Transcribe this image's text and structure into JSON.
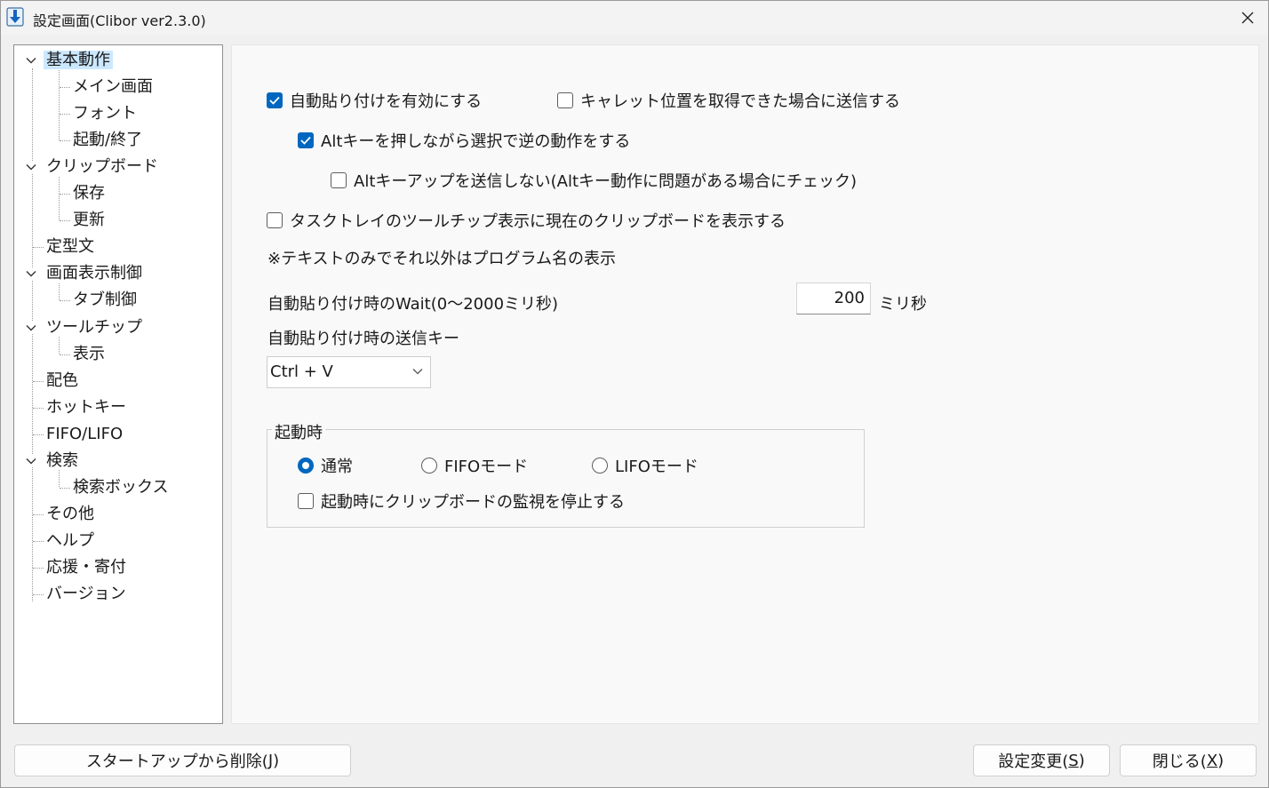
{
  "window": {
    "title": "設定画面(Clibor ver2.3.0)",
    "close_glyph": "✕"
  },
  "tree": {
    "items": [
      {
        "label": "基本動作",
        "level": 0,
        "expanded": true,
        "selected": true
      },
      {
        "label": "メイン画面",
        "level": 1
      },
      {
        "label": "フォント",
        "level": 1
      },
      {
        "label": "起動/終了",
        "level": 1
      },
      {
        "label": "クリップボード",
        "level": 0,
        "expanded": true
      },
      {
        "label": "保存",
        "level": 1
      },
      {
        "label": "更新",
        "level": 1
      },
      {
        "label": "定型文",
        "level": 0
      },
      {
        "label": "画面表示制御",
        "level": 0,
        "expanded": true
      },
      {
        "label": "タブ制御",
        "level": 1
      },
      {
        "label": "ツールチップ",
        "level": 0,
        "expanded": true
      },
      {
        "label": "表示",
        "level": 1
      },
      {
        "label": "配色",
        "level": 0
      },
      {
        "label": "ホットキー",
        "level": 0
      },
      {
        "label": "FIFO/LIFO",
        "level": 0
      },
      {
        "label": "検索",
        "level": 0,
        "expanded": true
      },
      {
        "label": "検索ボックス",
        "level": 1
      },
      {
        "label": "その他",
        "level": 0
      },
      {
        "label": "ヘルプ",
        "level": 0
      },
      {
        "label": "応援・寄付",
        "level": 0
      },
      {
        "label": "バージョン",
        "level": 0
      }
    ]
  },
  "settings": {
    "auto_paste": {
      "label": "自動貼り付けを有効にする",
      "checked": true
    },
    "caret_send": {
      "label": "キャレット位置を取得できた場合に送信する",
      "checked": false
    },
    "alt_reverse": {
      "label": "Altキーを押しながら選択で逆の動作をする",
      "checked": true
    },
    "alt_keyup": {
      "label": "Altキーアップを送信しない(Altキー動作に問題がある場合にチェック)",
      "checked": false
    },
    "tasktray_tip": {
      "label": "タスクトレイのツールチップ表示に現在のクリップボードを表示する",
      "checked": false
    },
    "note": "※テキストのみでそれ以外はプログラム名の表示",
    "wait_label": "自動貼り付け時のWait(0～2000ミリ秒)",
    "wait_value": "200",
    "wait_unit": "ミリ秒",
    "send_key_label": "自動貼り付け時の送信キー",
    "send_key_value": "Ctrl + V"
  },
  "startup": {
    "group_label": "起動時",
    "modes": [
      {
        "label": "通常",
        "selected": true
      },
      {
        "label": "FIFOモード",
        "selected": false
      },
      {
        "label": "LIFOモード",
        "selected": false
      }
    ],
    "stop_monitor": {
      "label": "起動時にクリップボードの監視を停止する",
      "checked": false
    }
  },
  "buttons": {
    "remove_startup": {
      "label": "スタートアップから削除(",
      "key": "J",
      "close": ")"
    },
    "apply": {
      "label": "設定変更(",
      "key": "S",
      "close": ")"
    },
    "close": {
      "label": "閉じる(",
      "key": "X",
      "close": ")"
    }
  },
  "colors": {
    "accent": "#0067c0",
    "selection": "#cce8ff"
  }
}
